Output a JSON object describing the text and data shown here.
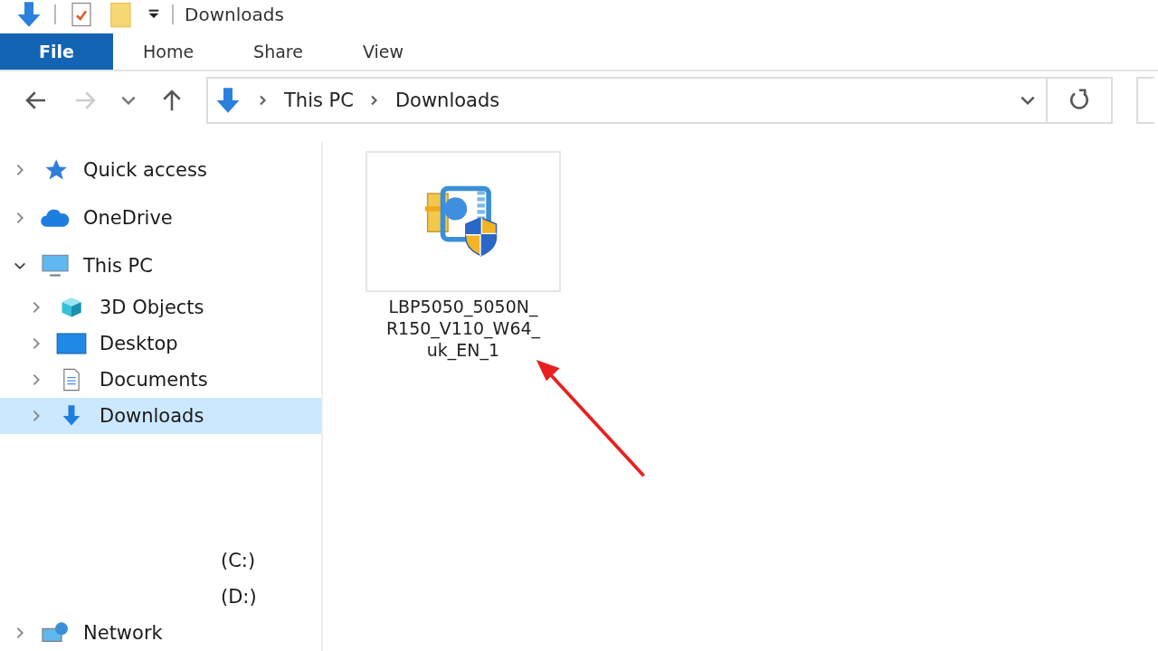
{
  "window": {
    "title": "Downloads"
  },
  "ribbon": {
    "tabs": [
      {
        "label": "File",
        "selected": true
      },
      {
        "label": "Home",
        "selected": false
      },
      {
        "label": "Share",
        "selected": false
      },
      {
        "label": "View",
        "selected": false
      }
    ]
  },
  "address_bar": {
    "path": [
      "This PC",
      "Downloads"
    ]
  },
  "sidebar": {
    "items": [
      {
        "label": "Quick access",
        "kind": "star",
        "expanded": false,
        "selected": false
      },
      {
        "label": "OneDrive",
        "kind": "cloud",
        "expanded": false,
        "selected": false
      },
      {
        "label": "This PC",
        "kind": "pc",
        "expanded": true,
        "selected": false,
        "children": [
          {
            "label": "3D Objects",
            "kind": "cube",
            "expanded": false,
            "selected": false
          },
          {
            "label": "Desktop",
            "kind": "desktop",
            "expanded": false,
            "selected": false
          },
          {
            "label": "Documents",
            "kind": "doc",
            "expanded": false,
            "selected": false
          },
          {
            "label": "Downloads",
            "kind": "download",
            "expanded": false,
            "selected": true
          }
        ],
        "drives": [
          {
            "label": "(C:)"
          },
          {
            "label": "(D:)"
          }
        ]
      },
      {
        "label": "Network",
        "kind": "network",
        "expanded": false,
        "selected": false
      }
    ]
  },
  "files": [
    {
      "name": "LBP5050_5050N_\nR150_V110_W64_\nuk_EN_1",
      "selected": false
    }
  ]
}
